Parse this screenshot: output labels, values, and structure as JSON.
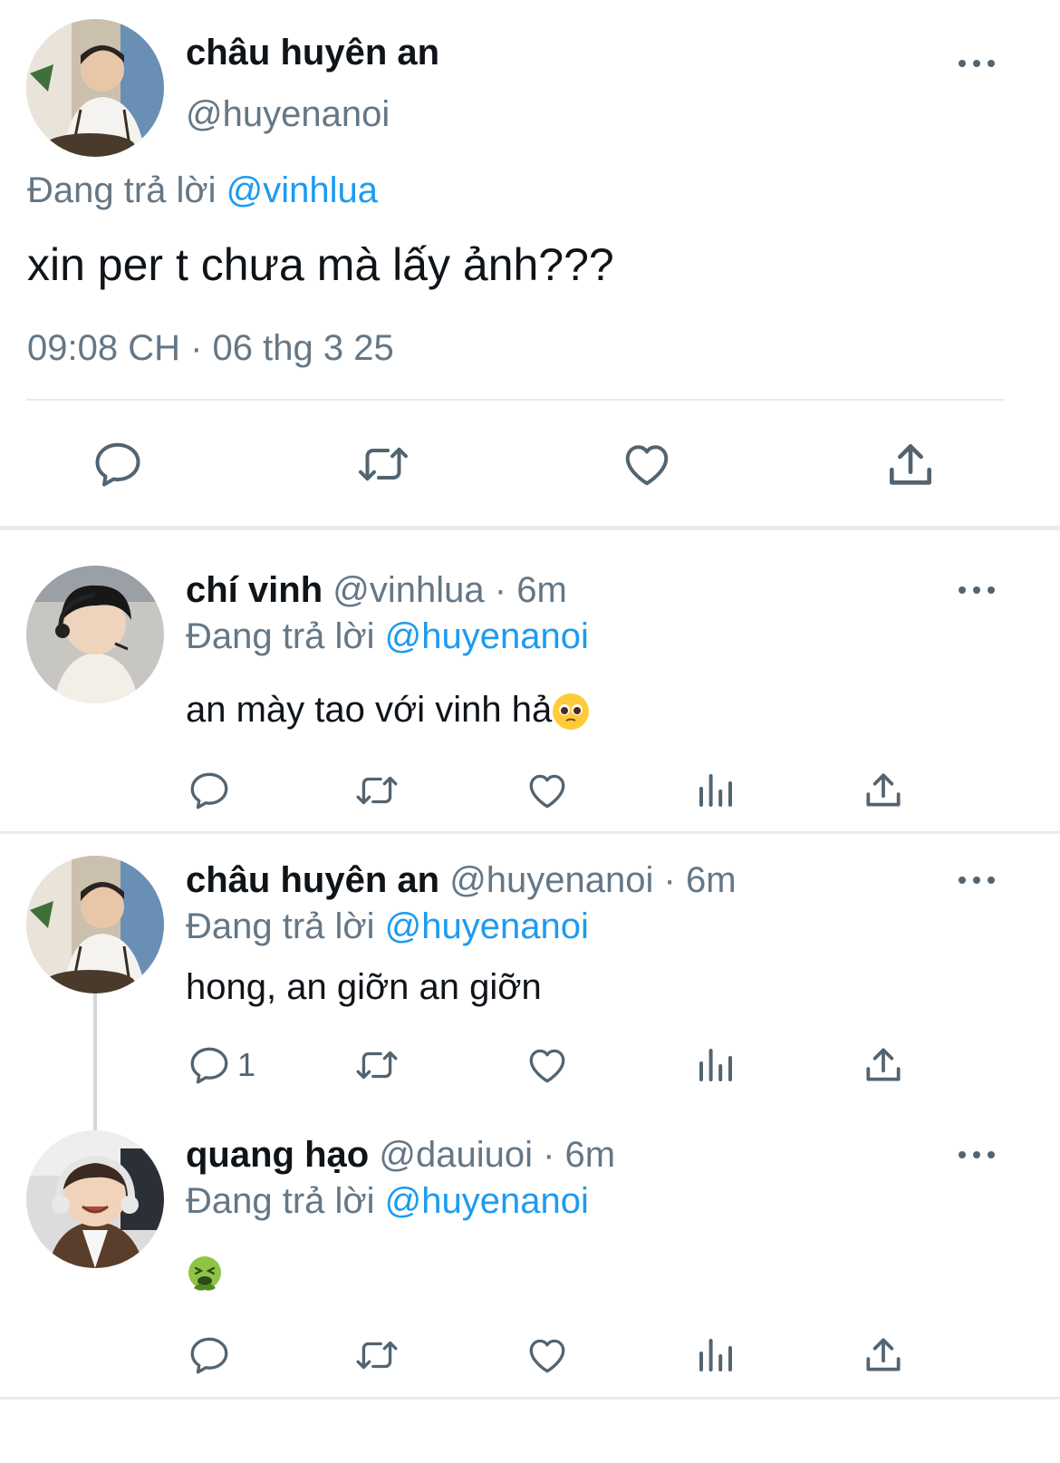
{
  "main_tweet": {
    "name": "châu huyên an",
    "handle": "@huyenanoi",
    "replying_prefix": "Đang trả lời",
    "replying_to": "@vinhlua",
    "text": "xin per t chưa mà lấy ảnh???",
    "timestamp": "09:08 CH · 06 thg 3 25"
  },
  "replies": [
    {
      "name": "chí vinh",
      "handle": "@vinhlua",
      "time": "· 6m",
      "replying_prefix": "Đang trả lời",
      "replying_to": "@huyenanoi",
      "text": "an mày tao với vinh hả",
      "emoji": "pleading-face"
    },
    {
      "name": "châu huyên an",
      "handle": "@huyenanoi",
      "time": "· 6m",
      "replying_prefix": "Đang trả lời",
      "replying_to": "@huyenanoi",
      "text": "hong, an giỡn an giỡn",
      "reply_count": "1"
    },
    {
      "name": "quang hạo",
      "handle": "@dauiuoi",
      "time": "· 6m",
      "replying_prefix": "Đang trả lời",
      "replying_to": "@huyenanoi",
      "text": "",
      "emoji": "vomiting-face"
    }
  ],
  "colors": {
    "link_blue": "#1d9bf0",
    "muted_gray": "#657786",
    "icon_gray": "#536471",
    "separator": "#e6ecf0"
  }
}
